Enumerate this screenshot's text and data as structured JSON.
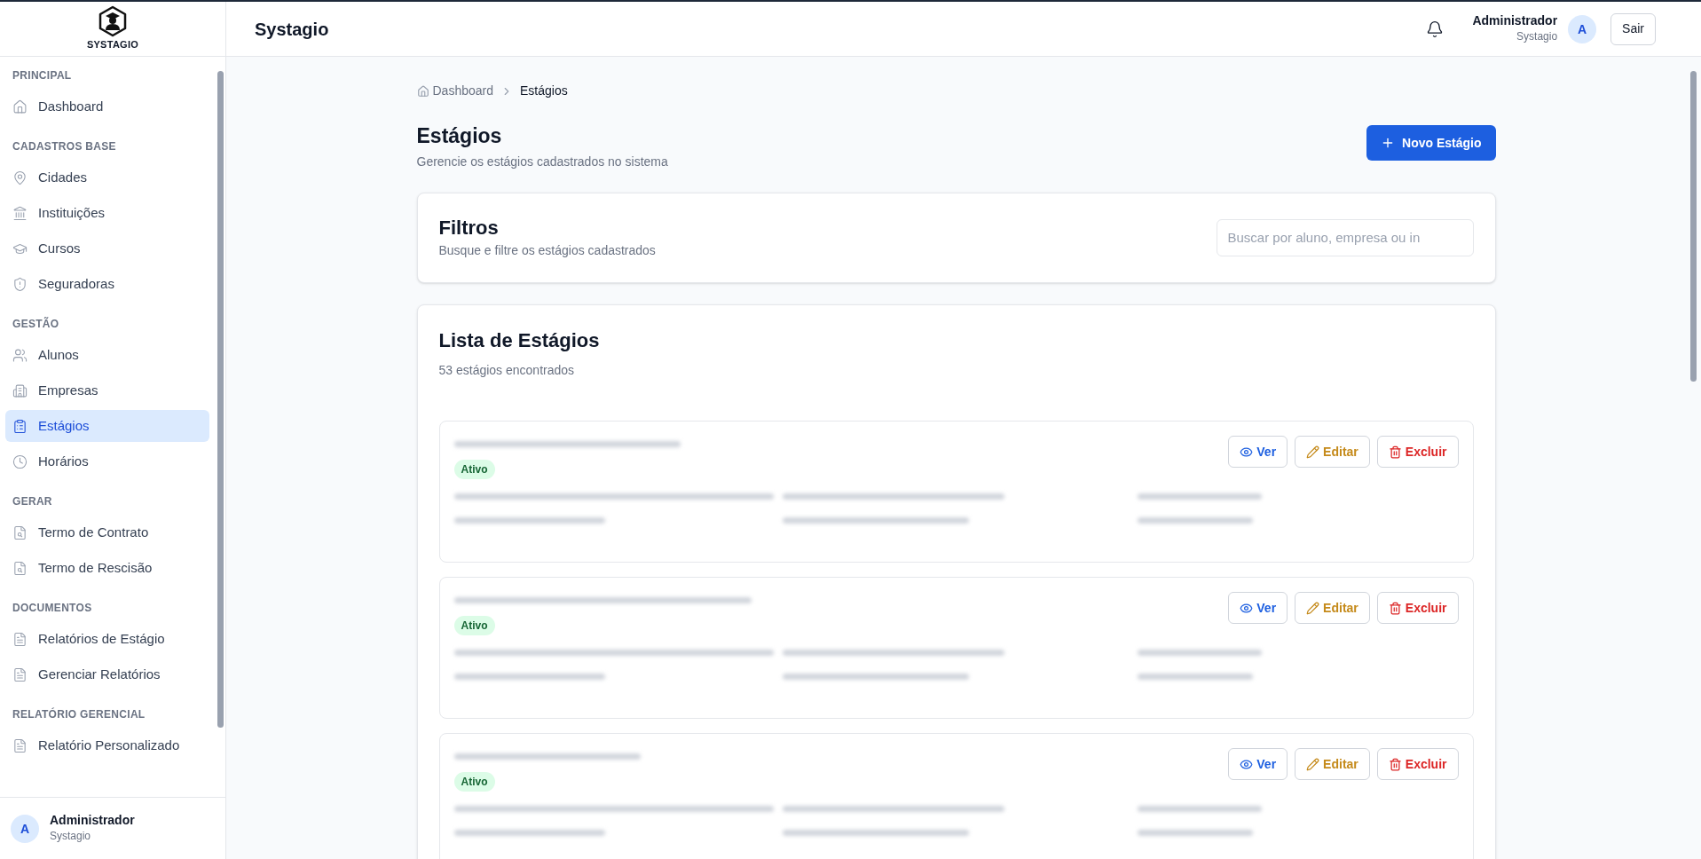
{
  "brand": {
    "name": "SYSTAGIO"
  },
  "sidebar": {
    "sections": [
      {
        "title": "PRINCIPAL",
        "items": [
          {
            "label": "Dashboard",
            "kind": "home",
            "selected": false
          }
        ]
      },
      {
        "title": "CADASTROS BASE",
        "items": [
          {
            "label": "Cidades",
            "kind": "pin",
            "selected": false
          },
          {
            "label": "Instituições",
            "kind": "bank",
            "selected": false
          },
          {
            "label": "Cursos",
            "kind": "cap",
            "selected": false
          },
          {
            "label": "Seguradoras",
            "kind": "shield",
            "selected": false
          }
        ]
      },
      {
        "title": "GESTÃO",
        "items": [
          {
            "label": "Alunos",
            "kind": "users",
            "selected": false
          },
          {
            "label": "Empresas",
            "kind": "building",
            "selected": false
          },
          {
            "label": "Estágios",
            "kind": "clipboard",
            "selected": true
          },
          {
            "label": "Horários",
            "kind": "clock",
            "selected": false
          }
        ]
      },
      {
        "title": "GERAR",
        "items": [
          {
            "label": "Termo de Contrato",
            "kind": "filesearch",
            "selected": false
          },
          {
            "label": "Termo de Rescisão",
            "kind": "filesearch",
            "selected": false
          }
        ]
      },
      {
        "title": "DOCUMENTOS",
        "items": [
          {
            "label": "Relatórios de Estágio",
            "kind": "file",
            "selected": false
          },
          {
            "label": "Gerenciar Relatórios",
            "kind": "file",
            "selected": false
          }
        ]
      },
      {
        "title": "RELATÓRIO GERENCIAL",
        "items": [
          {
            "label": "Relatório Personalizado",
            "kind": "file",
            "selected": false
          }
        ]
      }
    ],
    "user": {
      "avatar": "A",
      "name": "Administrador",
      "org": "Systagio"
    }
  },
  "header": {
    "title": "Systagio",
    "user": {
      "name": "Administrador",
      "org": "Systagio",
      "avatar": "A"
    },
    "logout": "Sair"
  },
  "breadcrumb": [
    {
      "label": "Dashboard"
    },
    {
      "label": "Estágios"
    }
  ],
  "page": {
    "title": "Estágios",
    "subtitle": "Gerencie os estágios cadastrados no sistema",
    "new_button": "Novo Estágio"
  },
  "filters": {
    "title": "Filtros",
    "subtitle": "Busque e filtre os estágios cadastrados",
    "search": {
      "placeholder": "Buscar por aluno, empresa ou in"
    }
  },
  "list": {
    "title": "Lista de Estágios",
    "count": "53 estágios encontrados",
    "items": [
      {
        "status": "Ativo",
        "kind": "active",
        "actions": {
          "view": "Ver",
          "edit": "Editar",
          "delete": "Excluir"
        }
      },
      {
        "status": "Ativo",
        "kind": "active",
        "actions": {
          "view": "Ver",
          "edit": "Editar",
          "delete": "Excluir"
        }
      },
      {
        "status": "Ativo",
        "kind": "active",
        "actions": {
          "view": "Ver",
          "edit": "Editar",
          "delete": "Excluir"
        }
      }
    ]
  }
}
